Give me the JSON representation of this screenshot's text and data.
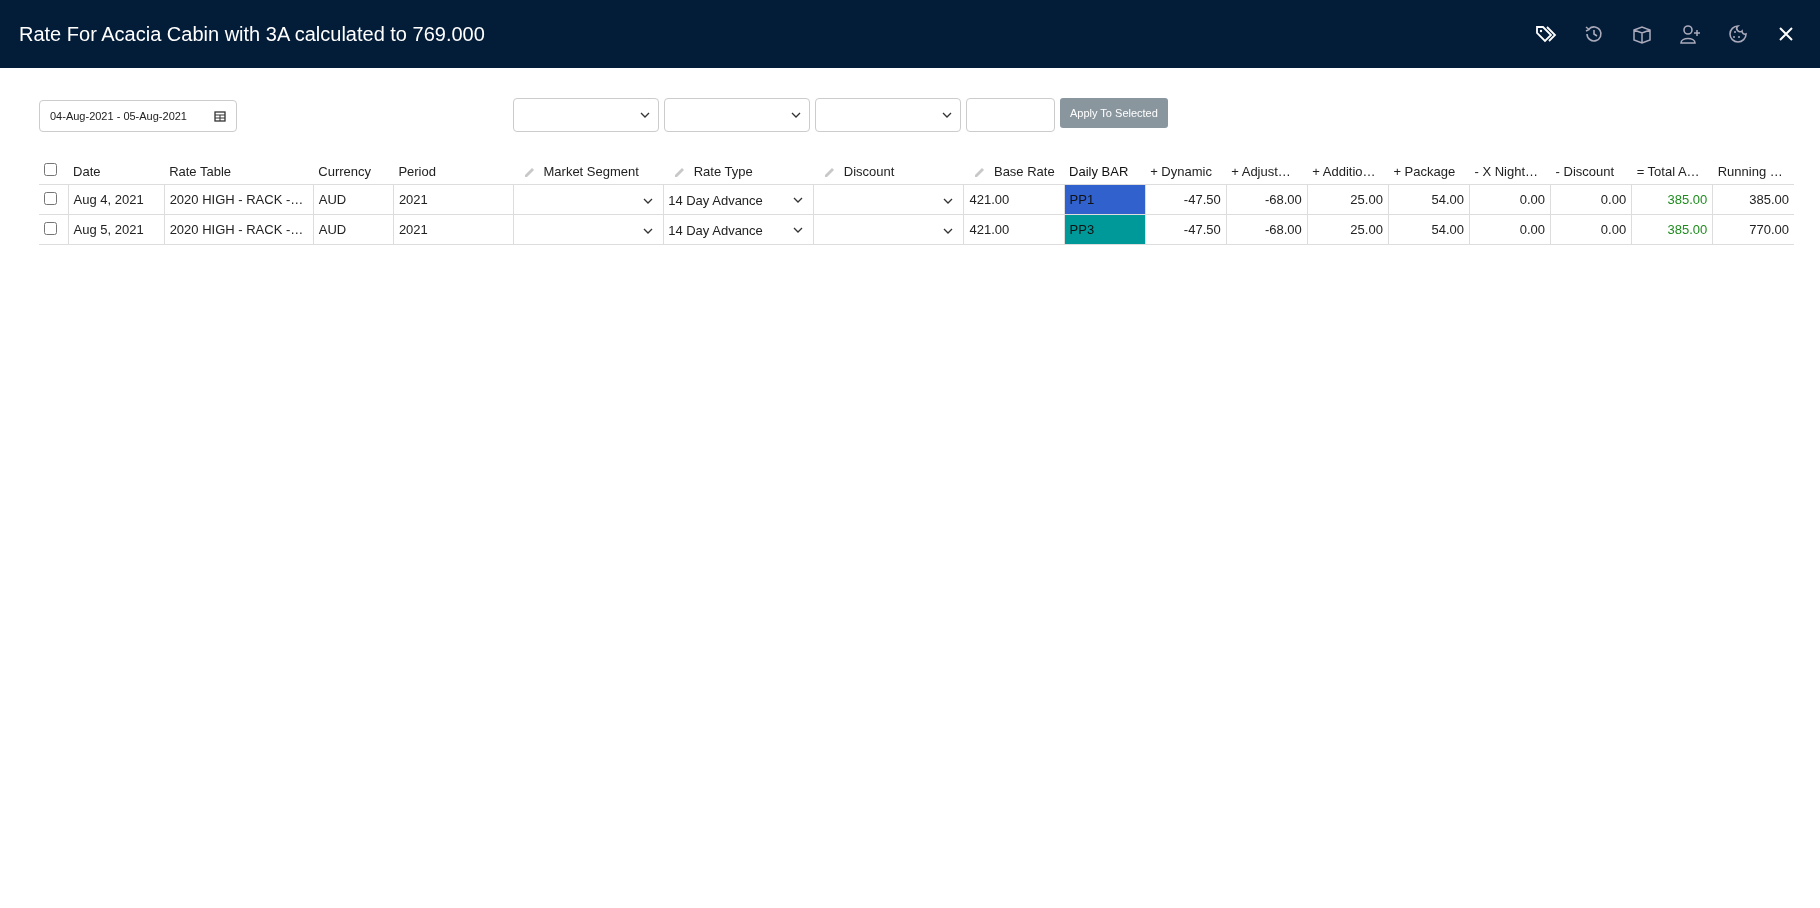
{
  "window": {
    "title": "Rate For Acacia Cabin with 3A calculated to 769.000",
    "actions": [
      {
        "kind": "tags"
      },
      {
        "kind": "history"
      },
      {
        "kind": "package"
      },
      {
        "kind": "add-guest"
      },
      {
        "kind": "cookie"
      },
      {
        "kind": "close"
      }
    ]
  },
  "toolbar": {
    "date_range": "04-Aug-2021 - 05-Aug-2021",
    "bulk_fields": [
      {
        "kind": "select"
      },
      {
        "kind": "select"
      },
      {
        "kind": "select"
      },
      {
        "kind": "input"
      }
    ],
    "apply_button": {
      "label": "Apply To Selected",
      "disabled": true
    }
  },
  "table": {
    "select_all_checked": false,
    "columns": [
      {
        "label": "Date",
        "kind": "text",
        "editable": false
      },
      {
        "label": "Rate Table",
        "kind": "text",
        "editable": false
      },
      {
        "label": "Currency",
        "kind": "text",
        "editable": false
      },
      {
        "label": "Period",
        "kind": "text",
        "editable": false
      },
      {
        "label": "Market Segment",
        "kind": "dropdown",
        "editable": true
      },
      {
        "label": "Rate Type",
        "kind": "dropdown",
        "editable": true
      },
      {
        "label": "Discount",
        "kind": "dropdown",
        "editable": true
      },
      {
        "label": "Base Rate",
        "kind": "text",
        "editable": true
      },
      {
        "label": "Daily BAR",
        "kind": "swatch",
        "editable": false
      },
      {
        "label": "+ Dynamic",
        "kind": "number",
        "editable": false
      },
      {
        "label": "+ Adjust…",
        "kind": "number",
        "editable": false
      },
      {
        "label": "+ Additio…",
        "kind": "number",
        "editable": false
      },
      {
        "label": "+ Package",
        "kind": "number",
        "editable": false
      },
      {
        "label": "- X Night…",
        "kind": "number",
        "editable": false
      },
      {
        "label": "- Discount",
        "kind": "number",
        "editable": false
      },
      {
        "label": "= Total A…",
        "kind": "total",
        "editable": false
      },
      {
        "label": "Running …",
        "kind": "number",
        "editable": false
      }
    ],
    "rows": [
      {
        "checked": false,
        "color": "#3161cc",
        "cells": [
          "Aug 4, 2021",
          "2020 HIGH - RACK -…",
          "AUD",
          "2021",
          null,
          "14 Day Advance",
          null,
          "421.00",
          "PP1",
          "-47.50",
          "-68.00",
          "25.00",
          "54.00",
          "0.00",
          "0.00",
          "385.00",
          "385.00"
        ]
      },
      {
        "checked": false,
        "color": "#009999",
        "cells": [
          "Aug 5, 2021",
          "2020 HIGH - RACK -…",
          "AUD",
          "2021",
          null,
          "14 Day Advance",
          null,
          "421.00",
          "PP3",
          "-47.50",
          "-68.00",
          "25.00",
          "54.00",
          "0.00",
          "0.00",
          "385.00",
          "770.00"
        ]
      }
    ]
  }
}
